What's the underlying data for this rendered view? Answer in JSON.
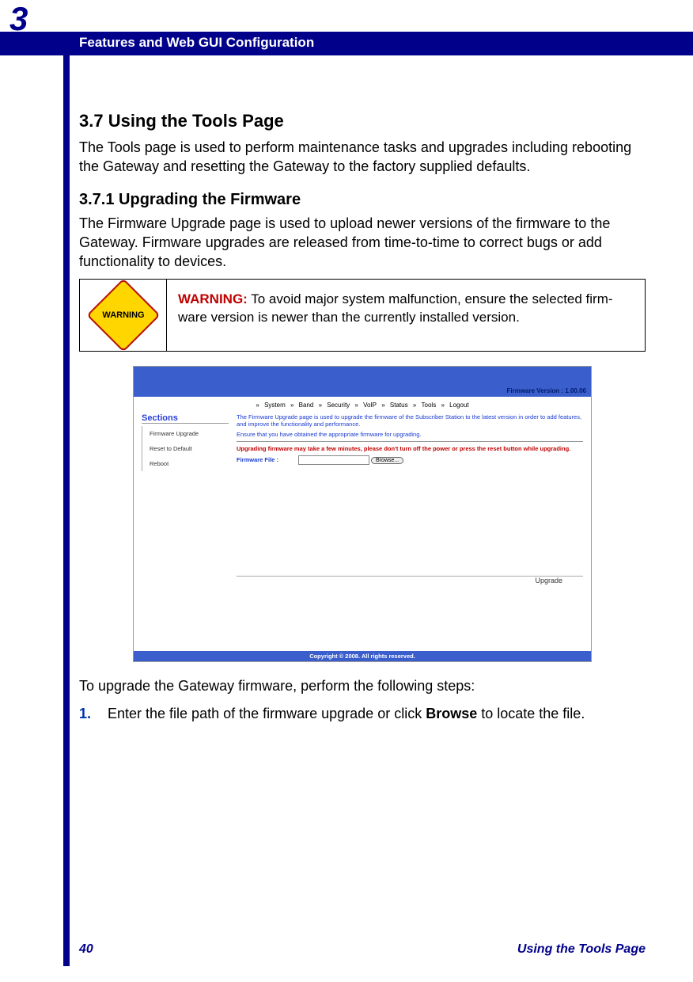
{
  "chapter_number": "3",
  "header_title": "Features and Web GUI Configuration",
  "section": {
    "number_title": "3.7 Using the Tools Page",
    "intro": "The Tools page is used to perform maintenance tasks and upgrades including rebooting the Gateway and resetting the Gateway to the factory supplied defaults."
  },
  "subsection": {
    "number_title": "3.7.1 Upgrading the Firmware",
    "intro": "The Firmware Upgrade page is used to upload newer versions of the firmware to the Gateway. Firmware upgrades are released from time-to-time to correct bugs or add functionality to devices."
  },
  "warning": {
    "icon_label": "WARNING",
    "prefix": "WARNING:",
    "text": " To avoid major system malfunction, ensure the selected firm­ware version is newer than the currently installed version."
  },
  "screenshot": {
    "fw_version": "Firmware Version : 1.00.06",
    "nav": [
      "System",
      "Band",
      "Security",
      "VoIP",
      "Status",
      "Tools",
      "Logout"
    ],
    "sections_label": "Sections",
    "menu": [
      "Firmware Upgrade",
      "Reset to Default",
      "Reboot"
    ],
    "desc1": "The Firmware Upgrade page is used to upgrade the firmware of the Subscriber Station to the latest version in order to add features, and improve the functionality and performance.",
    "desc2": "Ensure that you have obtained the appropriate firmware for upgrading.",
    "red_note": "Upgrading firmware may take a few minutes, please don't turn off the power or press the reset button while upgrading.",
    "file_label": "Firmware File :",
    "browse": "Browse...",
    "upgrade": "Upgrade",
    "copyright": "Copyright © 2008.  All rights reserved."
  },
  "after_shot": "To upgrade the Gateway firmware, perform the following steps:",
  "steps": {
    "s1_a": "Enter the file path of the firmware upgrade or click ",
    "s1_bold": "Browse",
    "s1_b": " to locate the file."
  },
  "footer": {
    "page": "40",
    "title": "Using the Tools Page"
  }
}
